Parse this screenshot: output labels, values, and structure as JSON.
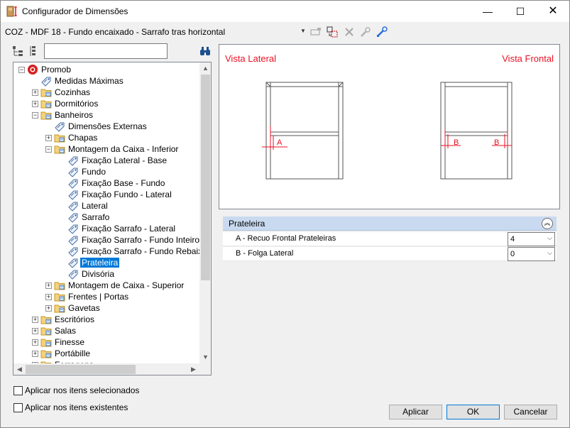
{
  "window": {
    "title": "Configurador de Dimensões",
    "minimize": "—",
    "maximize": "☐",
    "close": "✕"
  },
  "toolbar": {
    "item_selector": "COZ - MDF 18 - Fundo encaixado - Sarrafo tras horizontal"
  },
  "search": {
    "value": "",
    "placeholder": ""
  },
  "tree": {
    "items": [
      {
        "label": "Promob",
        "level": 0,
        "expander": "-",
        "icon": "promob-logo-icon"
      },
      {
        "label": "Medidas Máximas",
        "level": 1,
        "expander": "",
        "icon": "tag-icon"
      },
      {
        "label": "Cozinhas",
        "level": 1,
        "expander": "+",
        "icon": "folder-icon"
      },
      {
        "label": "Dormitórios",
        "level": 1,
        "expander": "+",
        "icon": "folder-icon"
      },
      {
        "label": "Banheiros",
        "level": 1,
        "expander": "-",
        "icon": "folder-icon"
      },
      {
        "label": "Dimensões Externas",
        "level": 2,
        "expander": "",
        "icon": "tag-icon"
      },
      {
        "label": "Chapas",
        "level": 2,
        "expander": "+",
        "icon": "folder-icon"
      },
      {
        "label": "Montagem da Caixa - Inferior",
        "level": 2,
        "expander": "-",
        "icon": "folder-icon"
      },
      {
        "label": "Fixação Lateral - Base",
        "level": 3,
        "expander": "",
        "icon": "tag-icon"
      },
      {
        "label": "Fundo",
        "level": 3,
        "expander": "",
        "icon": "tag-icon"
      },
      {
        "label": "Fixação Base - Fundo",
        "level": 3,
        "expander": "",
        "icon": "tag-icon"
      },
      {
        "label": "Fixação Fundo - Lateral",
        "level": 3,
        "expander": "",
        "icon": "tag-icon"
      },
      {
        "label": "Lateral",
        "level": 3,
        "expander": "",
        "icon": "tag-icon"
      },
      {
        "label": "Sarrafo",
        "level": 3,
        "expander": "",
        "icon": "tag-icon"
      },
      {
        "label": "Fixação Sarrafo - Lateral",
        "level": 3,
        "expander": "",
        "icon": "tag-icon"
      },
      {
        "label": "Fixação Sarrafo - Fundo Inteiro",
        "level": 3,
        "expander": "",
        "icon": "tag-icon"
      },
      {
        "label": "Fixação Sarrafo - Fundo Rebaixado",
        "level": 3,
        "expander": "",
        "icon": "tag-icon"
      },
      {
        "label": "Prateleira",
        "level": 3,
        "expander": "",
        "icon": "tag-icon",
        "selected": true
      },
      {
        "label": "Divisória",
        "level": 3,
        "expander": "",
        "icon": "tag-icon"
      },
      {
        "label": "Montagem de Caixa - Superior",
        "level": 2,
        "expander": "+",
        "icon": "folder-icon"
      },
      {
        "label": "Frentes | Portas",
        "level": 2,
        "expander": "+",
        "icon": "folder-icon"
      },
      {
        "label": "Gavetas",
        "level": 2,
        "expander": "+",
        "icon": "folder-icon"
      },
      {
        "label": "Escritórios",
        "level": 1,
        "expander": "+",
        "icon": "folder-icon"
      },
      {
        "label": "Salas",
        "level": 1,
        "expander": "+",
        "icon": "folder-icon"
      },
      {
        "label": "Finesse",
        "level": 1,
        "expander": "+",
        "icon": "folder-icon"
      },
      {
        "label": "Portábille",
        "level": 1,
        "expander": "+",
        "icon": "folder-icon"
      },
      {
        "label": "Ferragens",
        "level": 1,
        "expander": "+",
        "icon": "folder-icon"
      }
    ]
  },
  "preview": {
    "side_label": "Vista Lateral",
    "front_label": "Vista Frontal",
    "dim_a": "A",
    "dim_b": "B",
    "accent": "#e81123"
  },
  "properties": {
    "section_title": "Prateleira",
    "rows": [
      {
        "name": "A - Recuo Frontal Prateleiras",
        "value": "4"
      },
      {
        "name": "B - Folga Lateral",
        "value": "0"
      }
    ]
  },
  "options": {
    "apply_selected": "Aplicar nos itens selecionados",
    "apply_existing": "Aplicar nos itens existentes"
  },
  "buttons": {
    "apply": "Aplicar",
    "ok": "OK",
    "cancel": "Cancelar"
  }
}
